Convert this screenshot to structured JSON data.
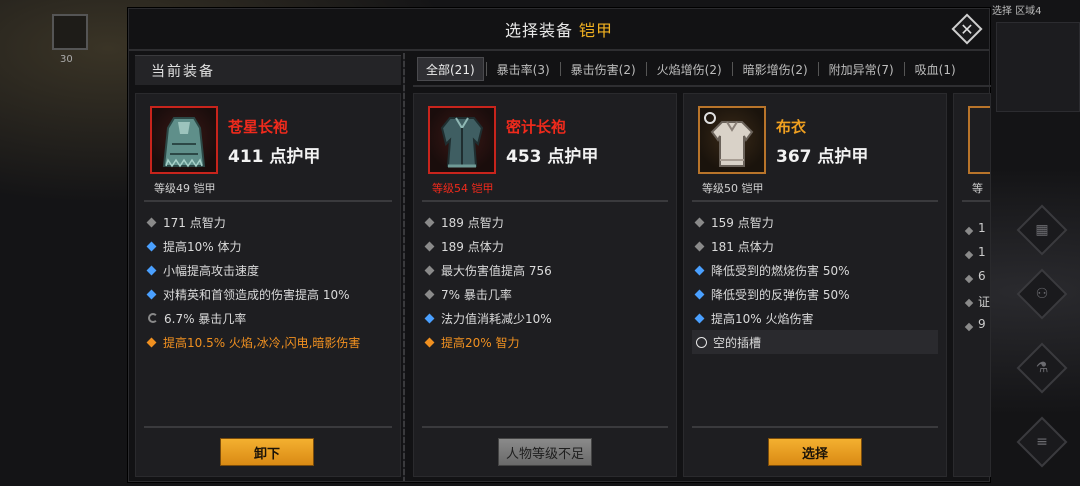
{
  "background": {
    "left_count": "30",
    "right_label": "选择 区域4"
  },
  "dialog": {
    "title": "选择装备",
    "title_category": "铠甲",
    "close_icon": "close-icon"
  },
  "current": {
    "header": "当前装备",
    "item": {
      "name": "苍星长袍",
      "armor": "411 点护甲",
      "level": "等级49 铠甲",
      "stats": [
        {
          "mark": "grey",
          "text": "171 点智力"
        },
        {
          "mark": "blue",
          "text": "提高10% 体力"
        },
        {
          "mark": "blue",
          "text": "小幅提高攻击速度"
        },
        {
          "mark": "blue",
          "text": "对精英和首领造成的伤害提高 10%"
        },
        {
          "mark": "crit",
          "text": "6.7% 暴击几率"
        },
        {
          "mark": "orange",
          "text": "提高10.5% 火焰,冰冷,闪电,暗影伤害"
        }
      ]
    },
    "button": "卸下"
  },
  "tabs": [
    {
      "label": "全部(21)",
      "active": true
    },
    {
      "label": "暴击率(3)",
      "active": false
    },
    {
      "label": "暴击伤害(2)",
      "active": false
    },
    {
      "label": "火焰增伤(2)",
      "active": false
    },
    {
      "label": "暗影增伤(2)",
      "active": false
    },
    {
      "label": "附加异常(7)",
      "active": false
    },
    {
      "label": "吸血(1)",
      "active": false
    }
  ],
  "candidates": [
    {
      "name": "密计长袍",
      "armor": "453 点护甲",
      "level": "等级54 铠甲",
      "stats": [
        {
          "mark": "grey",
          "text": "189 点智力"
        },
        {
          "mark": "grey",
          "text": "189 点体力"
        },
        {
          "mark": "grey",
          "text": "最大伤害值提高 756"
        },
        {
          "mark": "grey",
          "text": "7% 暴击几率"
        },
        {
          "mark": "blue",
          "text": "法力值消耗减少10%"
        },
        {
          "mark": "orange",
          "text": "提高20% 智力"
        }
      ],
      "button": "人物等级不足"
    },
    {
      "name": "布衣",
      "armor": "367 点护甲",
      "level": "等级50 铠甲",
      "stats": [
        {
          "mark": "grey",
          "text": "159 点智力"
        },
        {
          "mark": "grey",
          "text": "181 点体力"
        },
        {
          "mark": "blue",
          "text": "降低受到的燃烧伤害 50%"
        },
        {
          "mark": "blue",
          "text": "降低受到的反弹伤害 50%"
        },
        {
          "mark": "blue",
          "text": "提高10% 火焰伤害"
        },
        {
          "mark": "empty",
          "text": "空的插槽"
        }
      ],
      "button": "选择"
    }
  ],
  "peek": {
    "level": "等",
    "chars": [
      "1",
      "1",
      "6",
      "证",
      "9"
    ]
  },
  "colors": {
    "accent": "#f0b020",
    "legendary": "#f02a1c",
    "rare": "#f0a020",
    "magic": "#4aa0ff"
  }
}
